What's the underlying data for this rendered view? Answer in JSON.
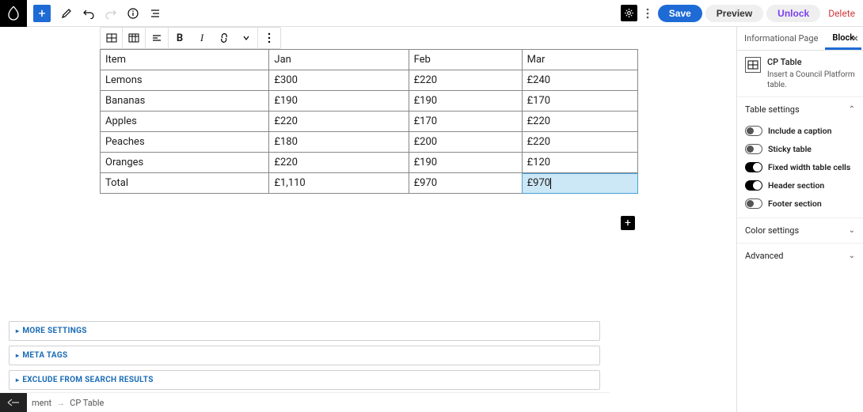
{
  "topbar": {
    "save": "Save",
    "preview": "Preview",
    "unlock": "Unlock",
    "delete": "Delete"
  },
  "table": {
    "headers": [
      "Item",
      "Jan",
      "Feb",
      "Mar"
    ],
    "rows": [
      [
        "Lemons",
        "£300",
        "£220",
        "£240"
      ],
      [
        "Bananas",
        "£190",
        "£190",
        "£170"
      ],
      [
        "Apples",
        "£220",
        "£170",
        "£220"
      ],
      [
        "Peaches",
        "£180",
        "£200",
        "£220"
      ],
      [
        "Oranges",
        "£220",
        "£190",
        "£120"
      ],
      [
        "Total",
        "£1,110",
        "£970",
        "£970"
      ]
    ],
    "selected_cell": [
      5,
      3
    ]
  },
  "accordions": [
    "MORE SETTINGS",
    "META TAGS",
    "EXCLUDE FROM SEARCH RESULTS"
  ],
  "breadcrumb": {
    "parent": "ment",
    "current": "CP Table"
  },
  "sidebar": {
    "tabs": [
      "Informational Page",
      "Block"
    ],
    "active_tab": 1,
    "block": {
      "title": "CP Table",
      "desc": "Insert a Council Platform table."
    },
    "sections": {
      "table_settings": "Table settings",
      "color_settings": "Color settings",
      "advanced": "Advanced"
    },
    "toggles": [
      {
        "label": "Include a caption",
        "on": false
      },
      {
        "label": "Sticky table",
        "on": false
      },
      {
        "label": "Fixed width table cells",
        "on": true
      },
      {
        "label": "Header section",
        "on": true
      },
      {
        "label": "Footer section",
        "on": false
      }
    ]
  }
}
